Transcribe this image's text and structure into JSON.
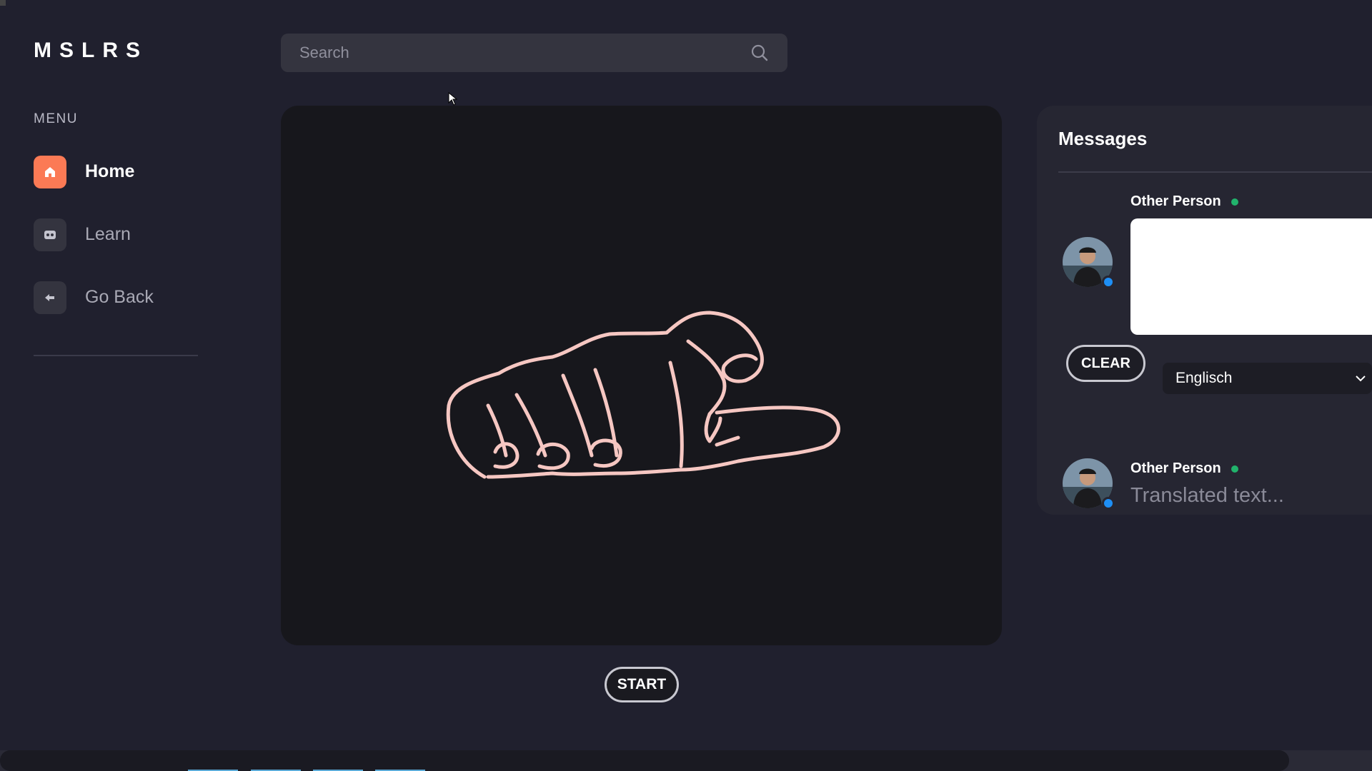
{
  "app": {
    "logo": "MSLRS"
  },
  "sidebar": {
    "menu_label": "MENU",
    "items": [
      {
        "label": "Home",
        "icon": "home-icon",
        "active": true
      },
      {
        "label": "Learn",
        "icon": "robot-icon",
        "active": false
      },
      {
        "label": "Go Back",
        "icon": "arrow-left-icon",
        "active": false
      }
    ]
  },
  "search": {
    "placeholder": "Search",
    "icon": "search-icon"
  },
  "video": {
    "start_label": "START",
    "stroke_color": "#f6c7c2"
  },
  "messages": {
    "title": "Messages",
    "entries": [
      {
        "sender": "Other Person",
        "status": "online",
        "text": ""
      },
      {
        "sender": "Other Person",
        "status": "online",
        "text": "Translated text..."
      }
    ],
    "clear_label": "CLEAR",
    "language": {
      "selected": "Englisch"
    }
  },
  "colors": {
    "background": "#20202e",
    "accent": "#fb7a55",
    "online": "#21b36c",
    "avatar_badge": "#1e8ff5"
  }
}
